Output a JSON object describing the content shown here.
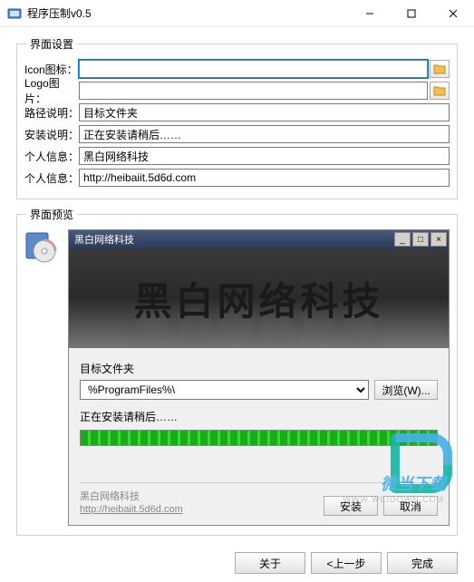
{
  "window": {
    "title": "程序压制v0.5",
    "min": "—",
    "max": "☐",
    "close": "✕"
  },
  "settings": {
    "legend": "界面设置",
    "icon_label": "Icon图标：",
    "icon_value": "",
    "logo_label": "Logo图片：",
    "logo_value": "",
    "path_label": "路径说明：",
    "path_value": "目标文件夹",
    "install_label": "安装说明：",
    "install_value": "正在安装请稍后……",
    "info1_label": "个人信息：",
    "info1_value": "黑白网络科技",
    "info2_label": "个人信息：",
    "info2_value": "http://heibaiit.5d6d.com"
  },
  "preview": {
    "legend": "界面预览",
    "titlebar": "黑白网络科技",
    "banner_text": "黑白网络科技",
    "path_label": "目标文件夹",
    "path_value": "%ProgramFiles%\\",
    "browse_label": "浏览(W)...",
    "install_label": "正在安装请稍后……",
    "company": "黑白网络科技",
    "url": "http://heibaiit.5d6d.com",
    "install_btn": "安装",
    "cancel_btn": "取消"
  },
  "bottom": {
    "about": "关于",
    "prev": "<上一步",
    "finish": "完成"
  },
  "watermark": {
    "text": "微当下载",
    "sub": "WWW.WEIDOWN.COM"
  }
}
